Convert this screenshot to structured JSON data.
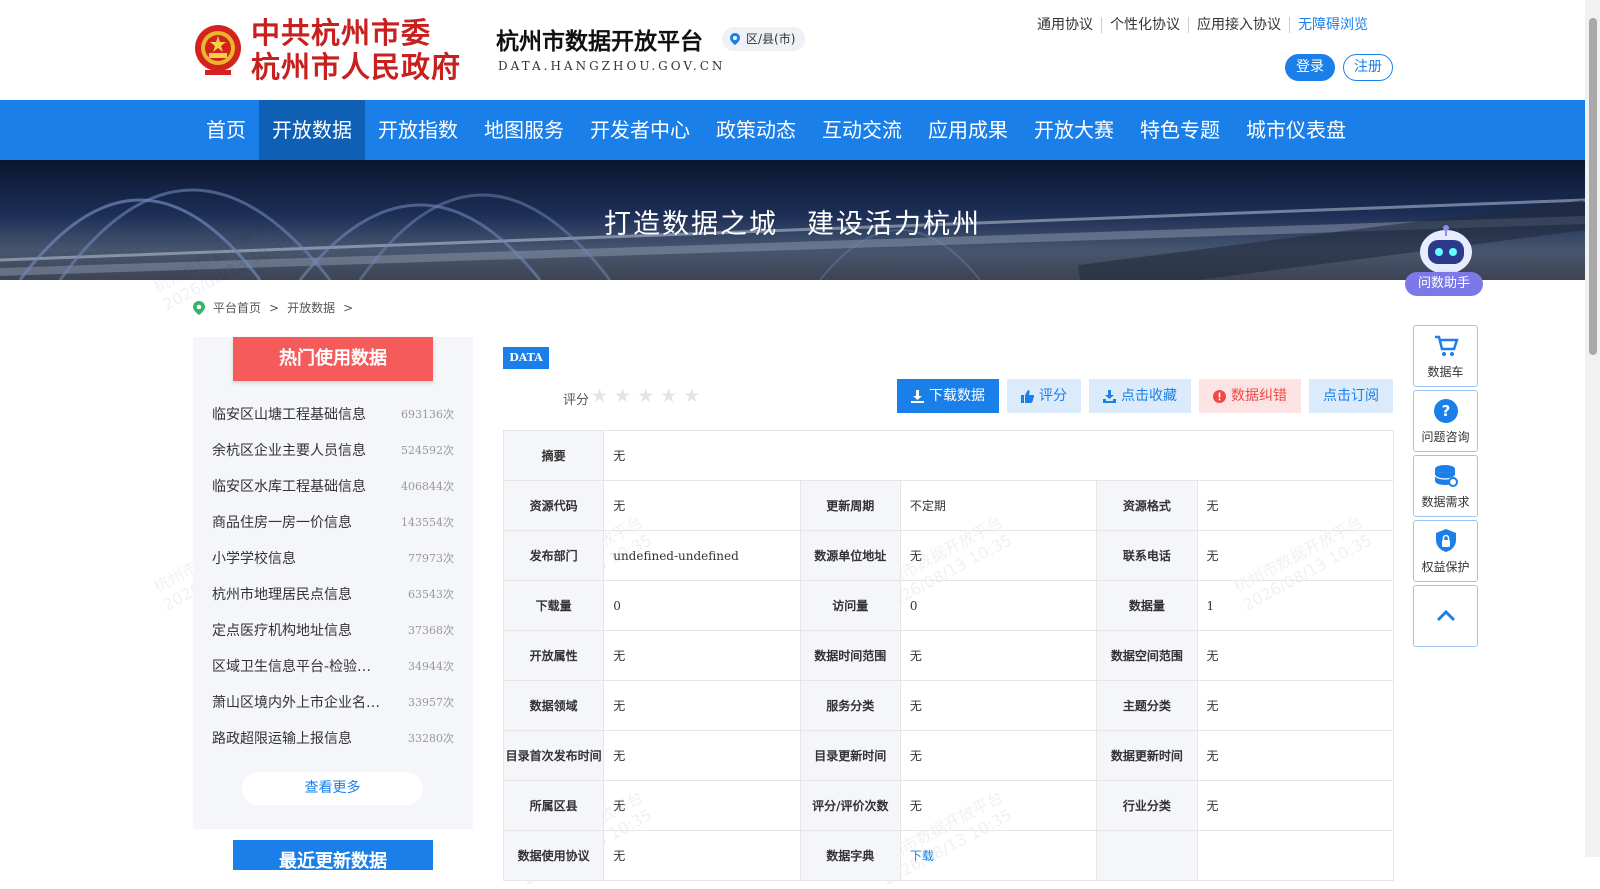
{
  "header": {
    "gov_line1": "中共杭州市委",
    "gov_line2": "杭州市人民政府",
    "site_title": "杭州市数据开放平台",
    "site_domain": "DATA.HANGZHOU.GOV.CN",
    "region_label": "区/县(市)",
    "top_links": [
      "通用协议",
      "个性化协议",
      "应用接入协议",
      "无障碍浏览"
    ],
    "login": "登录",
    "register": "注册"
  },
  "nav": {
    "items": [
      "首页",
      "开放数据",
      "开放指数",
      "地图服务",
      "开发者中心",
      "政策动态",
      "互动交流",
      "应用成果",
      "开放大赛",
      "特色专题",
      "城市仪表盘"
    ],
    "active": "开放数据"
  },
  "banner": {
    "text": "打造数据之城　建设活力杭州",
    "assistant": "问数助手"
  },
  "watermark": {
    "line1": "杭州市数据开放平台",
    "line2": "2026/08/13 10:35"
  },
  "breadcrumb": [
    "平台首页",
    ">",
    "开放数据",
    ">"
  ],
  "hot": {
    "title": "热门使用数据",
    "items": [
      {
        "name": "临安区山塘工程基础信息",
        "count": "693136次"
      },
      {
        "name": "余杭区企业主要人员信息",
        "count": "524592次"
      },
      {
        "name": "临安区水库工程基础信息",
        "count": "406844次"
      },
      {
        "name": "商品住房一房一价信息",
        "count": "143554次"
      },
      {
        "name": "小学学校信息",
        "count": "77973次"
      },
      {
        "name": "杭州市地理居民点信息",
        "count": "63543次"
      },
      {
        "name": "定点医疗机构地址信息",
        "count": "37368次"
      },
      {
        "name": "区域卫生信息平台-检验…",
        "count": "34944次"
      },
      {
        "name": "萧山区境内外上市企业名…",
        "count": "33957次"
      },
      {
        "name": "路政超限运输上报信息",
        "count": "33280次"
      }
    ],
    "more": "查看更多"
  },
  "recent": {
    "title": "最近更新数据"
  },
  "detail": {
    "tag": "DATA",
    "rating_label": "评分",
    "rating_value": 0,
    "actions": {
      "download": "下载数据",
      "rate": "评分",
      "favorite": "点击收藏",
      "correct": "数据纠错",
      "subscribe": "点击订阅"
    },
    "summary_key": "摘要",
    "summary_val": "无",
    "rows": [
      [
        [
          "资源代码",
          "无"
        ],
        [
          "更新周期",
          "不定期"
        ],
        [
          "资源格式",
          "无"
        ]
      ],
      [
        [
          "发布部门",
          "undefined-undefined"
        ],
        [
          "数源单位地址",
          "无"
        ],
        [
          "联系电话",
          "无"
        ]
      ],
      [
        [
          "下载量",
          "0"
        ],
        [
          "访问量",
          "0"
        ],
        [
          "数据量",
          "1"
        ]
      ],
      [
        [
          "开放属性",
          "无"
        ],
        [
          "数据时间范围",
          "无"
        ],
        [
          "数据空间范围",
          "无"
        ]
      ],
      [
        [
          "数据领域",
          "无"
        ],
        [
          "服务分类",
          "无"
        ],
        [
          "主题分类",
          "无"
        ]
      ],
      [
        [
          "目录首次发布时间",
          "无"
        ],
        [
          "目录更新时间",
          "无"
        ],
        [
          "数据更新时间",
          "无"
        ]
      ],
      [
        [
          "所属区县",
          "无"
        ],
        [
          "评分/评价次数",
          "无"
        ],
        [
          "行业分类",
          "无"
        ]
      ],
      [
        [
          "数据使用协议",
          "无"
        ],
        [
          "数据字典",
          "下载"
        ],
        [
          "",
          ""
        ]
      ]
    ]
  },
  "side_buttons": [
    {
      "label": "数据车",
      "icon": "cart-icon"
    },
    {
      "label": "问题咨询",
      "icon": "question-icon"
    },
    {
      "label": "数据需求",
      "icon": "database-icon"
    },
    {
      "label": "权益保护",
      "icon": "lock-icon"
    },
    {
      "label": "",
      "icon": "chevron-up-icon"
    }
  ],
  "colors": {
    "primary": "#1a7fe8",
    "nav_active": "#0f5fb5",
    "hot": "#f65b5b",
    "gov_red": "#c8201e"
  }
}
